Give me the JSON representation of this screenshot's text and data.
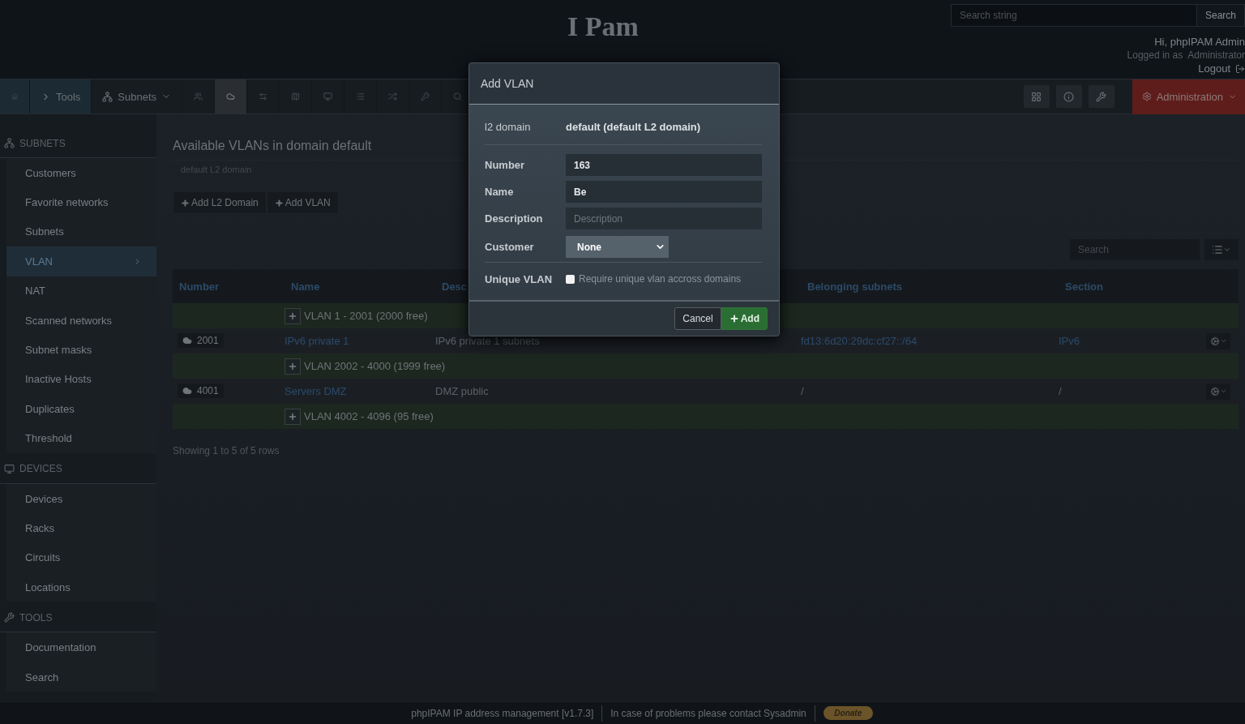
{
  "header": {
    "title": "I Pam",
    "search": {
      "placeholder": "Search string",
      "button": "Search"
    },
    "greeting": "Hi, phpIPAM Admin",
    "logged_in_label": "Logged in as",
    "role": "Administrator",
    "logout": "Logout"
  },
  "navbar": {
    "items": [
      {
        "kind": "home",
        "selected": false
      },
      {
        "kind": "tools",
        "label": "Tools",
        "selected": false
      },
      {
        "kind": "subnets",
        "label": "Subnets",
        "selected": false
      },
      {
        "kind": "users",
        "selected": false
      },
      {
        "kind": "cloud",
        "selected": true
      },
      {
        "kind": "arrows",
        "selected": false
      },
      {
        "kind": "map",
        "selected": false
      },
      {
        "kind": "monitor",
        "selected": false
      },
      {
        "kind": "list",
        "selected": false
      },
      {
        "kind": "shuffle",
        "selected": false
      },
      {
        "kind": "key",
        "selected": false
      },
      {
        "kind": "search",
        "selected": false
      }
    ],
    "right": [
      {
        "kind": "grid"
      },
      {
        "kind": "info"
      },
      {
        "kind": "wrench"
      }
    ],
    "admin": "Administration"
  },
  "sidebar": [
    {
      "title": "SUBNETS",
      "kind": "subnets",
      "items": [
        {
          "label": "Customers",
          "selected": false
        },
        {
          "label": "Favorite networks",
          "selected": false
        },
        {
          "label": "Subnets",
          "selected": false
        },
        {
          "label": "VLAN",
          "selected": true
        },
        {
          "label": "NAT",
          "selected": false
        },
        {
          "label": "Scanned networks",
          "selected": false
        },
        {
          "label": "Subnet masks",
          "selected": false
        },
        {
          "label": "Inactive Hosts",
          "selected": false
        },
        {
          "label": "Duplicates",
          "selected": false
        },
        {
          "label": "Threshold",
          "selected": false
        }
      ]
    },
    {
      "title": "DEVICES",
      "kind": "devices",
      "items": [
        {
          "label": "Devices",
          "selected": false
        },
        {
          "label": "Racks",
          "selected": false
        },
        {
          "label": "Circuits",
          "selected": false
        },
        {
          "label": "Locations",
          "selected": false
        }
      ]
    },
    {
      "title": "TOOLS",
      "kind": "tools",
      "items": [
        {
          "label": "Documentation",
          "selected": false
        },
        {
          "label": "Search",
          "selected": false
        }
      ]
    }
  ],
  "content": {
    "title": "Available VLANs in domain default",
    "subtitle": "default L2 domain",
    "buttons": [
      "Add L2 Domain",
      "Add VLAN"
    ],
    "search": {
      "placeholder": "Search"
    },
    "table": {
      "columns": [
        "Number",
        "Name",
        "Desc",
        "Belonging subnets",
        "Section"
      ],
      "rows": [
        {
          "kind": "free",
          "label": "VLAN 1 - 2001 (2000 free)"
        },
        {
          "kind": "vlan",
          "number": "2001",
          "name": "IPv6 private 1",
          "description": "IPv6 private 1 subnets",
          "subnets": "fd13:6d20:29dc:cf27::/64",
          "section": "IPv6"
        },
        {
          "kind": "free",
          "label": "VLAN 2002 - 4000 (1999 free)"
        },
        {
          "kind": "vlan",
          "number": "4001",
          "name": "Servers DMZ",
          "description": "DMZ public",
          "subnets": "/",
          "section": "/"
        },
        {
          "kind": "free",
          "label": "VLAN 4002 - 4096 (95 free)"
        }
      ]
    },
    "footer_info": "Showing 1 to 5 of 5 rows"
  },
  "modal": {
    "title": "Add VLAN",
    "l2_label": "l2 domain",
    "l2_value": "default (default L2 domain)",
    "fields": [
      {
        "label": "Number",
        "value": "163"
      },
      {
        "label": "Name",
        "value": "Be"
      },
      {
        "label": "Description",
        "placeholder": "Description"
      }
    ],
    "customer": {
      "label": "Customer",
      "value": "None"
    },
    "unique": {
      "label": "Unique VLAN",
      "text": "Require unique vlan accross domains",
      "checked": false
    },
    "cancel": "Cancel",
    "add": "Add"
  },
  "footer": {
    "version": "phpIPAM IP address management [v1.7.3]",
    "contact": "In case of problems please contact Sysadmin",
    "donate": "Donate"
  }
}
